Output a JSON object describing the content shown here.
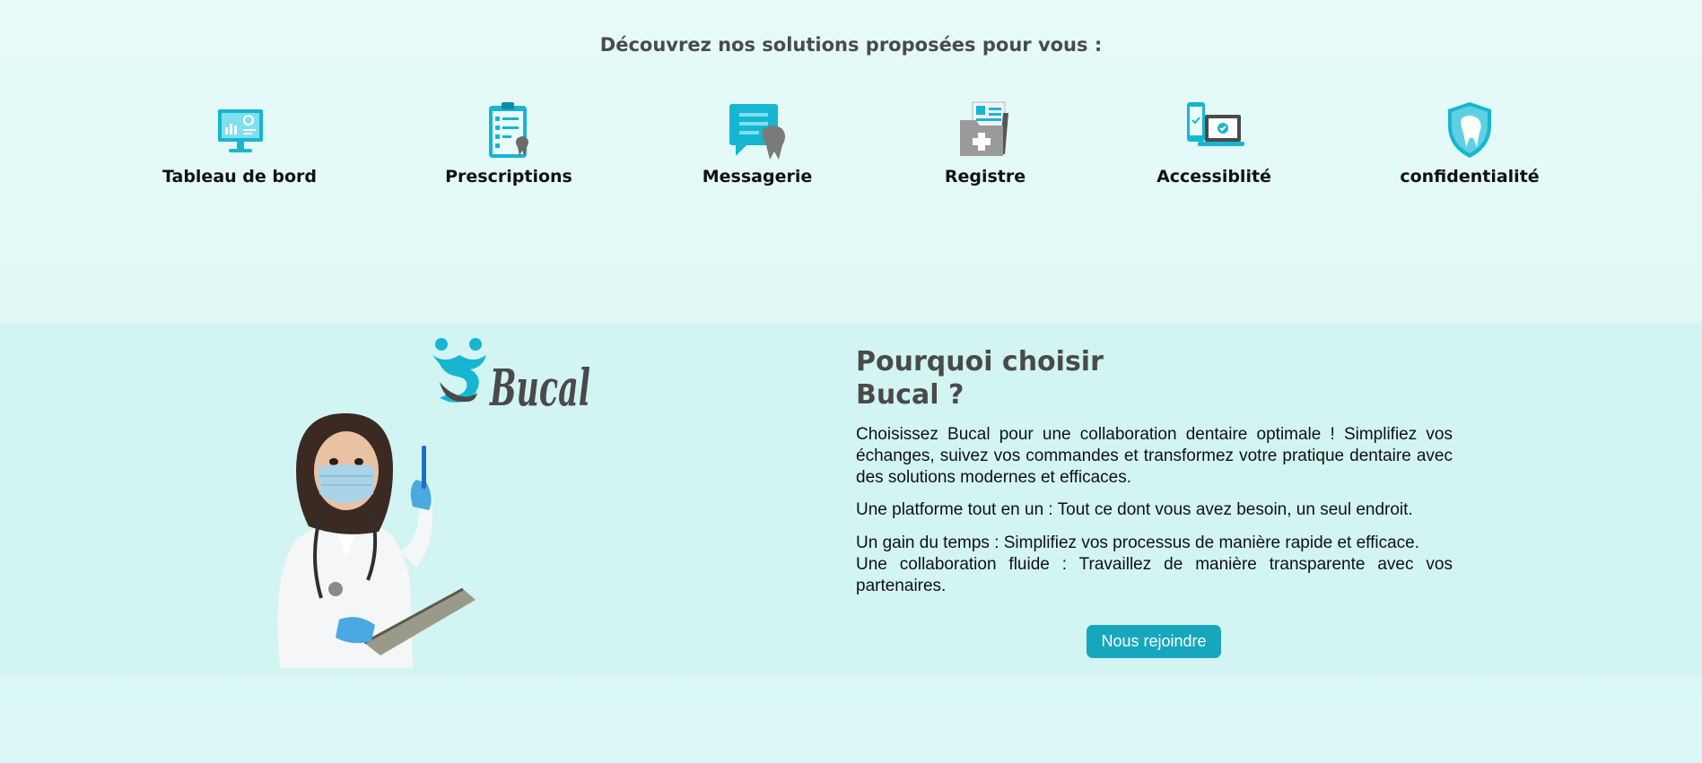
{
  "solutions": {
    "title": "Découvrez nos solutions proposées pour vous :",
    "items": [
      {
        "label": "Tableau de bord",
        "icon": "dashboard-monitor-icon"
      },
      {
        "label": "Prescriptions",
        "icon": "prescription-clipboard-icon"
      },
      {
        "label": "Messagerie",
        "icon": "message-chat-icon"
      },
      {
        "label": "Registre",
        "icon": "medical-folder-icon"
      },
      {
        "label": "Accessiblité",
        "icon": "devices-icon"
      },
      {
        "label": "confidentialité",
        "icon": "tooth-shield-icon"
      }
    ]
  },
  "brand": {
    "logo_text": "Bucal",
    "accent_color": "#16a7bd"
  },
  "why": {
    "title_line1": "Pourquoi choisir",
    "title_line2": "Bucal ?",
    "paragraph1": "Choisissez Bucal pour une collaboration dentaire optimale ! Simplifiez vos échanges, suivez vos commandes et transformez votre pratique dentaire avec des solutions modernes et efficaces.",
    "paragraph2": "Une platforme tout en un : Tout ce dont vous avez besoin, un seul endroit.",
    "paragraph3_line1": "Un gain du temps : Simplifiez vos processus de manière rapide et efficace.",
    "paragraph3_line2": "Une collaboration fluide : Travaillez de manière transparente avec vos partenaires.",
    "join_label": "Nous rejoindre"
  }
}
